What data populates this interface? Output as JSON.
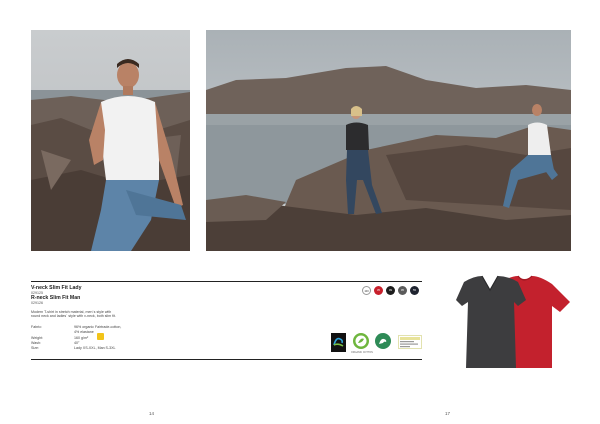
{
  "product": {
    "name_lady": "V-neck Slim Fit Lady",
    "code_lady": "029125",
    "name_man": "R-neck Slim Fit Man",
    "code_man": "029126",
    "description_line1": "Modern T-shirt in stretch material, men´s style with",
    "description_line2": "round neck and ladies´ style with v-neck, both slim fit."
  },
  "specs": [
    {
      "key": "Fabric:",
      "value": "96% organic Fairtrade-cotton,"
    },
    {
      "key": "",
      "value": "4% elastane"
    },
    {
      "key": "Weight:",
      "value": "160 g/m²"
    },
    {
      "key": "Wash:",
      "value": "40°"
    },
    {
      "key": "Size:",
      "value": "Lady XS-XXL, Man S-3XL"
    }
  ],
  "colors": [
    {
      "code": "100",
      "hex": "#ffffff"
    },
    {
      "code": "35",
      "hex": "#c8202c"
    },
    {
      "code": "99",
      "hex": "#1d1d1d"
    },
    {
      "code": "95",
      "hex": "#5b5b5b"
    },
    {
      "code": "55",
      "hex": "#1f2430"
    }
  ],
  "certifications": [
    {
      "icon": "fairtrade-icon",
      "label": ""
    },
    {
      "icon": "gots-organic-icon",
      "label": "ORGANIC COTTON"
    },
    {
      "icon": "nordic-swan-icon",
      "label": ""
    },
    {
      "icon": "oeko-tex-icon",
      "label": "OEKO-TEX"
    }
  ],
  "page_numbers": {
    "left": "14",
    "right": "17"
  },
  "product_colors": {
    "dark_tee": "#3d3d3f",
    "red_tee": "#c3212d"
  }
}
